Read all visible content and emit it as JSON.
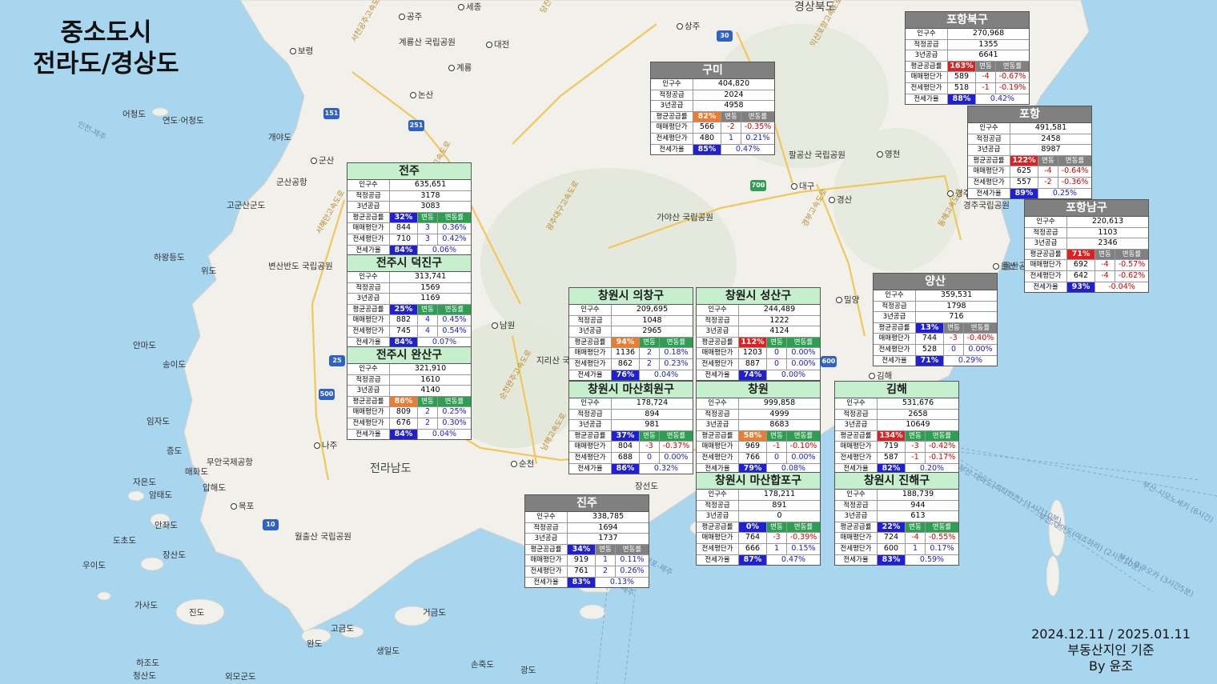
{
  "title": {
    "line1": "중소도시",
    "line2": "전라도/경상도"
  },
  "footer": {
    "line1": "2024.12.11 / 2025.01.11",
    "line2": "부동산지인 기준",
    "line3": "By 윤조"
  },
  "row_labels": {
    "population": "인구수",
    "proper_supply": "적정공급",
    "supply_3y": "3년공급",
    "avg_supply_rate": "평균공급률",
    "change": "변동",
    "change_rate": "변동률",
    "sale_price": "매매평단가",
    "jeonse_price": "전세평단가",
    "jeonse_ratio": "전세가율"
  },
  "colors": {
    "red": "#e02020",
    "orange": "#ee7b2e",
    "blue": "#1f1fd6",
    "header_green": "#c6efce",
    "header_gray": "#808080"
  },
  "map_labels": [
    {
      "text": "세종",
      "kind": "city"
    },
    {
      "text": "공주",
      "kind": "city"
    },
    {
      "text": "대전",
      "kind": "city"
    },
    {
      "text": "보령",
      "kind": "city"
    },
    {
      "text": "계룡",
      "kind": "city"
    },
    {
      "text": "논산",
      "kind": "city"
    },
    {
      "text": "상주",
      "kind": "city"
    },
    {
      "text": "경상북도",
      "kind": "region"
    },
    {
      "text": "군산",
      "kind": "city"
    },
    {
      "text": "대구",
      "kind": "city"
    },
    {
      "text": "경산",
      "kind": "city"
    },
    {
      "text": "영천",
      "kind": "city"
    },
    {
      "text": "경주",
      "kind": "city"
    },
    {
      "text": "울산",
      "kind": "city"
    },
    {
      "text": "밀양",
      "kind": "city"
    },
    {
      "text": "남원",
      "kind": "city"
    },
    {
      "text": "나주",
      "kind": "city"
    },
    {
      "text": "순천",
      "kind": "city"
    },
    {
      "text": "목포",
      "kind": "city"
    },
    {
      "text": "김해",
      "kind": "city"
    },
    {
      "text": "전라남도",
      "kind": "region"
    },
    {
      "text": "어청도",
      "kind": "island"
    },
    {
      "text": "연도·어청도",
      "kind": "island"
    },
    {
      "text": "개야도",
      "kind": "island"
    },
    {
      "text": "고군산군도",
      "kind": "island"
    },
    {
      "text": "하왕등도",
      "kind": "island"
    },
    {
      "text": "위도",
      "kind": "island"
    },
    {
      "text": "안마도",
      "kind": "island"
    },
    {
      "text": "송이도",
      "kind": "island"
    },
    {
      "text": "임자도",
      "kind": "island"
    },
    {
      "text": "증도",
      "kind": "island"
    },
    {
      "text": "매화도",
      "kind": "island"
    },
    {
      "text": "자은도",
      "kind": "island"
    },
    {
      "text": "암태도",
      "kind": "island"
    },
    {
      "text": "압해도",
      "kind": "island"
    },
    {
      "text": "안좌도",
      "kind": "island"
    },
    {
      "text": "도초도",
      "kind": "island"
    },
    {
      "text": "장산도",
      "kind": "island"
    },
    {
      "text": "우이도",
      "kind": "island"
    },
    {
      "text": "가사도",
      "kind": "island"
    },
    {
      "text": "진도",
      "kind": "island"
    },
    {
      "text": "완도",
      "kind": "island"
    },
    {
      "text": "고금도",
      "kind": "island"
    },
    {
      "text": "거금도",
      "kind": "island"
    },
    {
      "text": "생일도",
      "kind": "island"
    },
    {
      "text": "하조도",
      "kind": "island"
    },
    {
      "text": "청산도",
      "kind": "island"
    },
    {
      "text": "손죽도",
      "kind": "island"
    },
    {
      "text": "광도",
      "kind": "island"
    },
    {
      "text": "장선도",
      "kind": "island"
    },
    {
      "text": "외모군도",
      "kind": "island"
    },
    {
      "text": "계룡산 국립공원",
      "kind": "park"
    },
    {
      "text": "팔공산 국립공원",
      "kind": "park"
    },
    {
      "text": "가야산 국립공원",
      "kind": "park"
    },
    {
      "text": "경주국립공원",
      "kind": "park"
    },
    {
      "text": "변산반도 국립공원",
      "kind": "park"
    },
    {
      "text": "지리산 국립공원",
      "kind": "park"
    },
    {
      "text": "월출산 국립공원",
      "kind": "park"
    },
    {
      "text": "무안국제공항",
      "kind": "airport"
    },
    {
      "text": "군산공항",
      "kind": "airport"
    },
    {
      "text": "울산공항",
      "kind": "airport"
    },
    {
      "text": "서천공주고속도로",
      "kind": "road"
    },
    {
      "text": "당진영덕고속도로 (청주~상주)",
      "kind": "road"
    },
    {
      "text": "익산포항고속도로",
      "kind": "road"
    },
    {
      "text": "서해안고속도로",
      "kind": "road"
    },
    {
      "text": "광주대구고속도로",
      "kind": "road"
    },
    {
      "text": "순천완주고속도로",
      "kind": "road"
    },
    {
      "text": "남해고속도로",
      "kind": "road"
    },
    {
      "text": "중앙고속도로",
      "kind": "road"
    },
    {
      "text": "경부고속도로",
      "kind": "road"
    },
    {
      "text": "동해고속도로",
      "kind": "road"
    },
    {
      "text": "부산-오사카 (17시간30분)",
      "kind": "ferry"
    },
    {
      "text": "부산-시모노세키 (8시간)",
      "kind": "ferry"
    },
    {
      "text": "부산-대마도(히타카츠) (1시간10분)",
      "kind": "ferry"
    },
    {
      "text": "부산-대마도(이즈하라) (2시간10분)",
      "kind": "ferry"
    },
    {
      "text": "부산-후쿠오카 (3시간5분)",
      "kind": "ferry"
    },
    {
      "text": "여수-제주",
      "kind": "ferry"
    },
    {
      "text": "삼천포-제주",
      "kind": "ferry"
    },
    {
      "text": "인천-제주",
      "kind": "ferry"
    }
  ],
  "shields": [
    "151",
    "251",
    "30",
    "700",
    "25",
    "500",
    "10",
    "600"
  ],
  "cards": [
    {
      "name": "포항북구",
      "header": "gray",
      "population": "270,968",
      "proper_supply": "1355",
      "supply_3y": "6641",
      "avg_supply_rate": "163%",
      "rate_color": "#e02020",
      "sale_price": "589",
      "sale_change": "-4",
      "sale_change_rate": "-0.67%",
      "jeonse_price": "518",
      "jeonse_change": "-1",
      "jeonse_change_rate": "-0.19%",
      "jeonse_ratio": "88%",
      "jeonse_ratio_change": "0.42%"
    },
    {
      "name": "구미",
      "header": "gray",
      "population": "404,820",
      "proper_supply": "2024",
      "supply_3y": "4958",
      "avg_supply_rate": "82%",
      "rate_color": "#ee7b2e",
      "sale_price": "566",
      "sale_change": "-2",
      "sale_change_rate": "-0.35%",
      "jeonse_price": "480",
      "jeonse_change": "1",
      "jeonse_change_rate": "0.21%",
      "jeonse_ratio": "85%",
      "jeonse_ratio_change": "0.47%"
    },
    {
      "name": "포항",
      "header": "gray",
      "population": "491,581",
      "proper_supply": "2458",
      "supply_3y": "8987",
      "avg_supply_rate": "122%",
      "rate_color": "#e02020",
      "sale_price": "625",
      "sale_change": "-4",
      "sale_change_rate": "-0.64%",
      "jeonse_price": "557",
      "jeonse_change": "-2",
      "jeonse_change_rate": "-0.36%",
      "jeonse_ratio": "89%",
      "jeonse_ratio_change": "0.25%"
    },
    {
      "name": "전주",
      "header": "green",
      "population": "635,651",
      "proper_supply": "3178",
      "supply_3y": "3083",
      "avg_supply_rate": "32%",
      "rate_color": "#1f1fd6",
      "sale_price": "844",
      "sale_change": "3",
      "sale_change_rate": "0.36%",
      "jeonse_price": "710",
      "jeonse_change": "3",
      "jeonse_change_rate": "0.42%",
      "jeonse_ratio": "84%",
      "jeonse_ratio_change": "0.06%"
    },
    {
      "name": "포항남구",
      "header": "gray",
      "population": "220,613",
      "proper_supply": "1103",
      "supply_3y": "2346",
      "avg_supply_rate": "71%",
      "rate_color": "#e02020",
      "sale_price": "692",
      "sale_change": "-4",
      "sale_change_rate": "-0.57%",
      "jeonse_price": "642",
      "jeonse_change": "-4",
      "jeonse_change_rate": "-0.62%",
      "jeonse_ratio": "93%",
      "jeonse_ratio_change": "-0.04%"
    },
    {
      "name": "전주시 덕진구",
      "header": "green",
      "population": "313,741",
      "proper_supply": "1569",
      "supply_3y": "1169",
      "avg_supply_rate": "25%",
      "rate_color": "#1f1fd6",
      "sale_price": "882",
      "sale_change": "4",
      "sale_change_rate": "0.45%",
      "jeonse_price": "745",
      "jeonse_change": "4",
      "jeonse_change_rate": "0.54%",
      "jeonse_ratio": "84%",
      "jeonse_ratio_change": "0.07%"
    },
    {
      "name": "양산",
      "header": "gray",
      "population": "359,531",
      "proper_supply": "1798",
      "supply_3y": "716",
      "avg_supply_rate": "13%",
      "rate_color": "#1f1fd6",
      "sale_price": "744",
      "sale_change": "-3",
      "sale_change_rate": "-0.40%",
      "jeonse_price": "528",
      "jeonse_change": "0",
      "jeonse_change_rate": "0.00%",
      "jeonse_ratio": "71%",
      "jeonse_ratio_change": "0.29%"
    },
    {
      "name": "창원시 의창구",
      "header": "green",
      "population": "209,695",
      "proper_supply": "1048",
      "supply_3y": "2965",
      "avg_supply_rate": "94%",
      "rate_color": "#ee7b2e",
      "sale_price": "1136",
      "sale_change": "2",
      "sale_change_rate": "0.18%",
      "jeonse_price": "862",
      "jeonse_change": "2",
      "jeonse_change_rate": "0.23%",
      "jeonse_ratio": "76%",
      "jeonse_ratio_change": "0.04%"
    },
    {
      "name": "창원시 성산구",
      "header": "green",
      "population": "244,489",
      "proper_supply": "1222",
      "supply_3y": "4124",
      "avg_supply_rate": "112%",
      "rate_color": "#e02020",
      "sale_price": "1203",
      "sale_change": "0",
      "sale_change_rate": "0.00%",
      "jeonse_price": "887",
      "jeonse_change": "0",
      "jeonse_change_rate": "0.00%",
      "jeonse_ratio": "74%",
      "jeonse_ratio_change": "0.00%"
    },
    {
      "name": "전주시 완산구",
      "header": "green",
      "population": "321,910",
      "proper_supply": "1610",
      "supply_3y": "4140",
      "avg_supply_rate": "86%",
      "rate_color": "#ee7b2e",
      "sale_price": "809",
      "sale_change": "2",
      "sale_change_rate": "0.25%",
      "jeonse_price": "676",
      "jeonse_change": "2",
      "jeonse_change_rate": "0.30%",
      "jeonse_ratio": "84%",
      "jeonse_ratio_change": "0.04%"
    },
    {
      "name": "창원시 마산회원구",
      "header": "green",
      "population": "178,724",
      "proper_supply": "894",
      "supply_3y": "981",
      "avg_supply_rate": "37%",
      "rate_color": "#1f1fd6",
      "sale_price": "804",
      "sale_change": "-3",
      "sale_change_rate": "-0.37%",
      "jeonse_price": "688",
      "jeonse_change": "0",
      "jeonse_change_rate": "0.00%",
      "jeonse_ratio": "86%",
      "jeonse_ratio_change": "0.32%"
    },
    {
      "name": "창원",
      "header": "green",
      "population": "999,858",
      "proper_supply": "4999",
      "supply_3y": "8683",
      "avg_supply_rate": "58%",
      "rate_color": "#ee7b2e",
      "sale_price": "969",
      "sale_change": "-1",
      "sale_change_rate": "-0.10%",
      "jeonse_price": "766",
      "jeonse_change": "0",
      "jeonse_change_rate": "0.00%",
      "jeonse_ratio": "79%",
      "jeonse_ratio_change": "0.08%"
    },
    {
      "name": "김해",
      "header": "green",
      "population": "531,676",
      "proper_supply": "2658",
      "supply_3y": "10649",
      "avg_supply_rate": "134%",
      "rate_color": "#e02020",
      "sale_price": "719",
      "sale_change": "-3",
      "sale_change_rate": "-0.42%",
      "jeonse_price": "587",
      "jeonse_change": "-1",
      "jeonse_change_rate": "-0.17%",
      "jeonse_ratio": "82%",
      "jeonse_ratio_change": "0.20%"
    },
    {
      "name": "진주",
      "header": "gray",
      "population": "338,785",
      "proper_supply": "1694",
      "supply_3y": "1737",
      "avg_supply_rate": "34%",
      "rate_color": "#1f1fd6",
      "sale_price": "919",
      "sale_change": "1",
      "sale_change_rate": "0.11%",
      "jeonse_price": "761",
      "jeonse_change": "2",
      "jeonse_change_rate": "0.26%",
      "jeonse_ratio": "83%",
      "jeonse_ratio_change": "0.13%"
    },
    {
      "name": "창원시 마산합포구",
      "header": "green",
      "population": "178,211",
      "proper_supply": "891",
      "supply_3y": "0",
      "avg_supply_rate": "0%",
      "rate_color": "#1f1fd6",
      "sale_price": "764",
      "sale_change": "-3",
      "sale_change_rate": "-0.39%",
      "jeonse_price": "666",
      "jeonse_change": "1",
      "jeonse_change_rate": "0.15%",
      "jeonse_ratio": "87%",
      "jeonse_ratio_change": "0.47%"
    },
    {
      "name": "창원시 진해구",
      "header": "green",
      "population": "188,739",
      "proper_supply": "944",
      "supply_3y": "613",
      "avg_supply_rate": "22%",
      "rate_color": "#1f1fd6",
      "sale_price": "724",
      "sale_change": "-4",
      "sale_change_rate": "-0.55%",
      "jeonse_price": "600",
      "jeonse_change": "1",
      "jeonse_change_rate": "0.17%",
      "jeonse_ratio": "83%",
      "jeonse_ratio_change": "0.59%"
    }
  ]
}
